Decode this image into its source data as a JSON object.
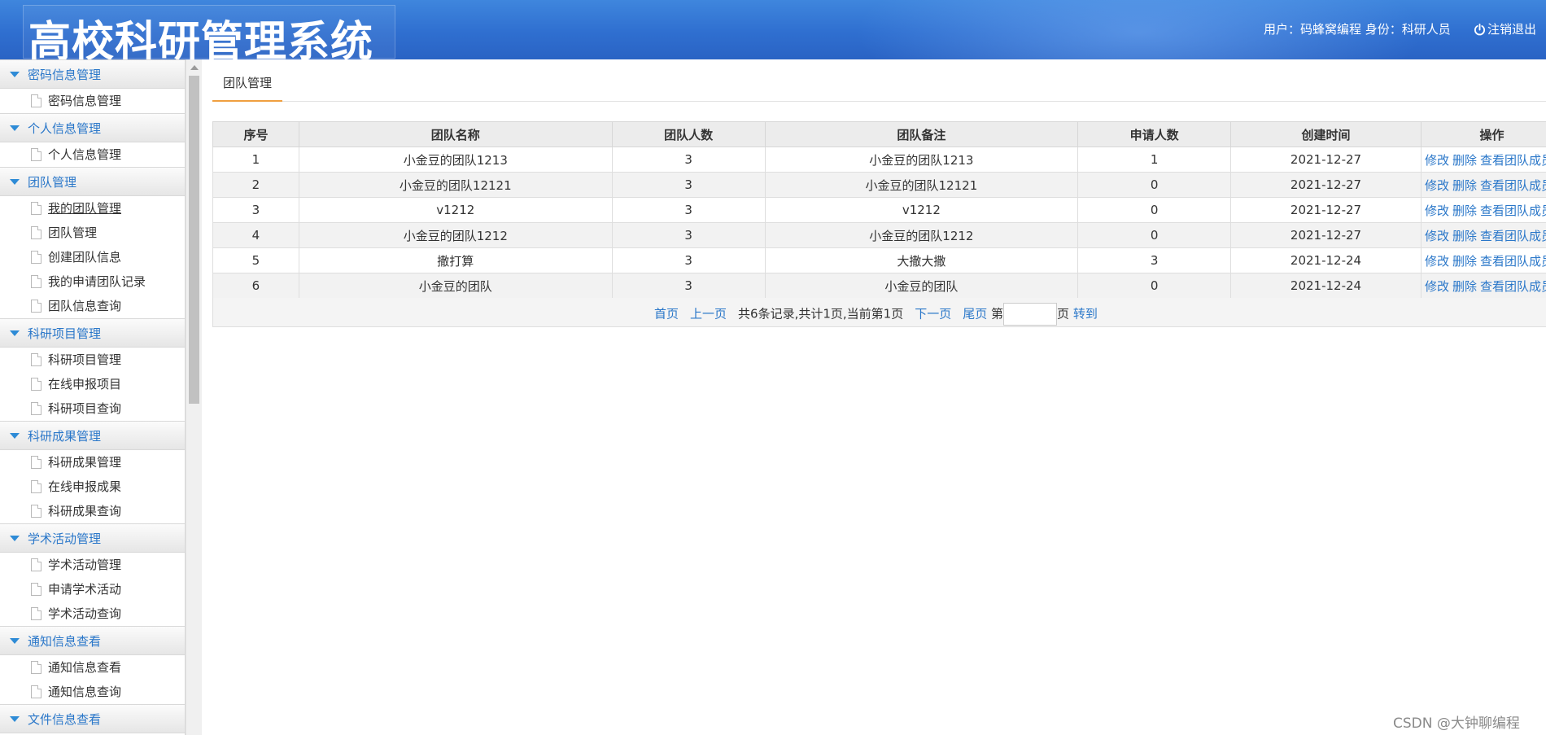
{
  "header": {
    "title": "高校科研管理系统",
    "user_info": "用户：码蜂窝编程 身份：科研人员",
    "logout_label": "注销退出"
  },
  "sidebar": {
    "sections": [
      {
        "label": "密码信息管理",
        "items": [
          "密码信息管理"
        ]
      },
      {
        "label": "个人信息管理",
        "items": [
          "个人信息管理"
        ]
      },
      {
        "label": "团队管理",
        "items": [
          "我的团队管理",
          "团队管理",
          "创建团队信息",
          "我的申请团队记录",
          "团队信息查询"
        ]
      },
      {
        "label": "科研项目管理",
        "items": [
          "科研项目管理",
          "在线申报项目",
          "科研项目查询"
        ]
      },
      {
        "label": "科研成果管理",
        "items": [
          "科研成果管理",
          "在线申报成果",
          "科研成果查询"
        ]
      },
      {
        "label": "学术活动管理",
        "items": [
          "学术活动管理",
          "申请学术活动",
          "学术活动查询"
        ]
      },
      {
        "label": "通知信息查看",
        "items": [
          "通知信息查看",
          "通知信息查询"
        ]
      },
      {
        "label": "文件信息查看",
        "items": []
      }
    ]
  },
  "main": {
    "tab_label": "团队管理",
    "table": {
      "headers": [
        "序号",
        "团队名称",
        "团队人数",
        "团队备注",
        "申请人数",
        "创建时间",
        "操作"
      ],
      "rows": [
        [
          "1",
          "小金豆的团队1213",
          "3",
          "小金豆的团队1213",
          "1",
          "2021-12-27"
        ],
        [
          "2",
          "小金豆的团队12121",
          "3",
          "小金豆的团队12121",
          "0",
          "2021-12-27"
        ],
        [
          "3",
          "v1212",
          "3",
          "v1212",
          "0",
          "2021-12-27"
        ],
        [
          "4",
          "小金豆的团队1212",
          "3",
          "小金豆的团队1212",
          "0",
          "2021-12-27"
        ],
        [
          "5",
          "撒打算",
          "3",
          "大撒大撒",
          "3",
          "2021-12-24"
        ],
        [
          "6",
          "小金豆的团队",
          "3",
          "小金豆的团队",
          "0",
          "2021-12-24"
        ]
      ],
      "actions": [
        "修改",
        "删除",
        "查看团队成员"
      ]
    },
    "pager": {
      "first": "首页",
      "prev": "上一页",
      "summary": "共6条记录,共计1页,当前第1页",
      "next": "下一页",
      "last": "尾页",
      "page_prefix": "第",
      "page_input_value": "",
      "page_suffix": "页",
      "go": "转到"
    }
  },
  "watermark": "CSDN @大钟聊编程",
  "colors": {
    "header_blue": "#2f6fd0",
    "link_blue": "#2a77c9",
    "tab_underline": "#f0a040"
  }
}
